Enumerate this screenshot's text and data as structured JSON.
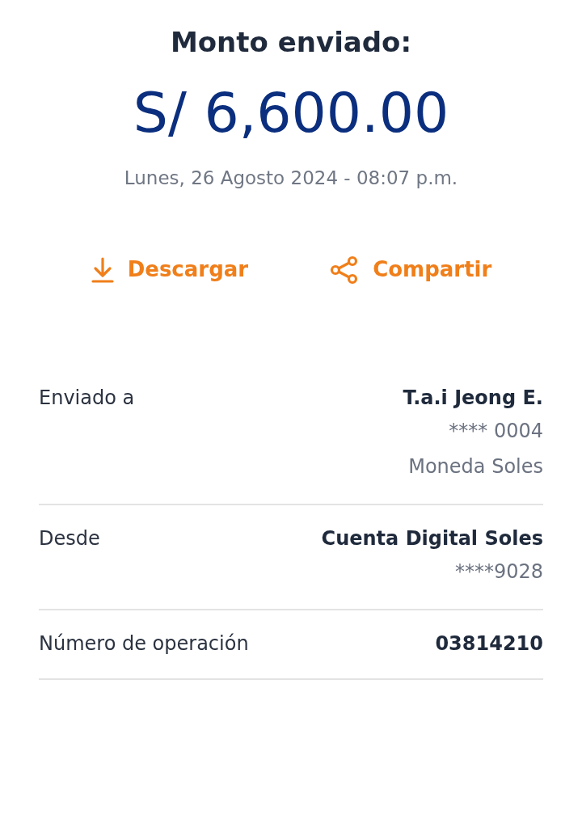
{
  "title": "Monto enviado:",
  "amount": "S/ 6,600.00",
  "date": "Lunes, 26 Agosto 2024 - 08:07 p.m.",
  "actions": [
    {
      "label": "Descargar",
      "kind": "download"
    },
    {
      "label": "Compartir",
      "kind": "share"
    }
  ],
  "details": [
    {
      "label": "Enviado a",
      "values": [
        {
          "text": "T.a.i Jeong E.",
          "kind": "primary"
        },
        {
          "text": "**** 0004",
          "kind": "secondary"
        },
        {
          "text": "Moneda Soles",
          "kind": "secondary"
        }
      ]
    },
    {
      "label": "Desde",
      "values": [
        {
          "text": "Cuenta Digital Soles",
          "kind": "primary"
        },
        {
          "text": "****9028",
          "kind": "secondary"
        }
      ]
    },
    {
      "label": "Número de operación",
      "values": [
        {
          "text": "03814210",
          "kind": "primary"
        }
      ]
    }
  ]
}
